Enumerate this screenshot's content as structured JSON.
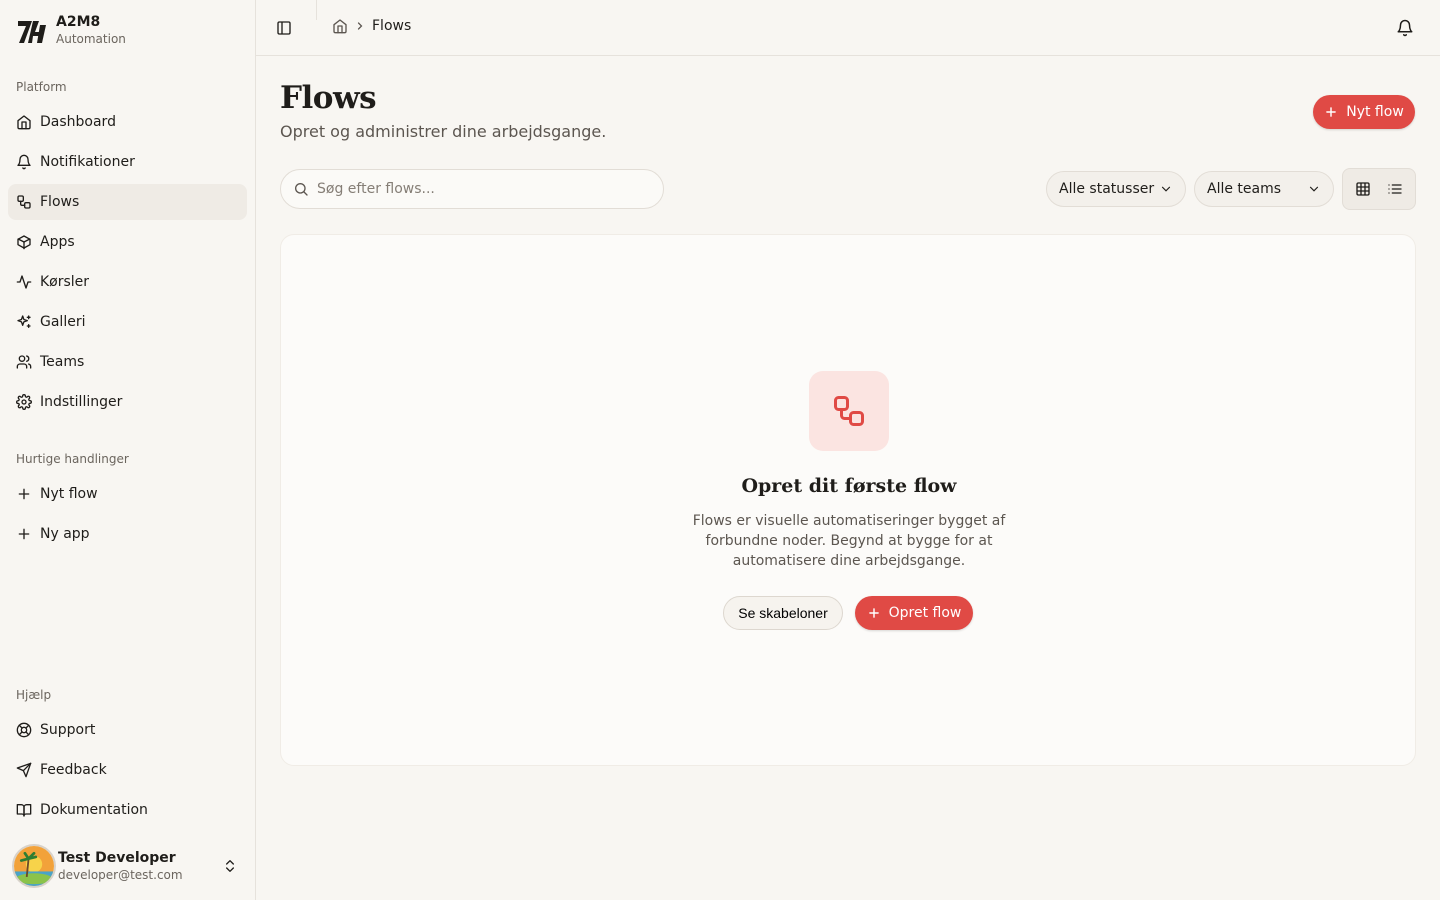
{
  "brand": {
    "name": "A2M8",
    "subtitle": "Automation"
  },
  "sidebar": {
    "platform_label": "Platform",
    "platform_items": [
      {
        "label": "Dashboard",
        "icon": "home-icon"
      },
      {
        "label": "Notifikationer",
        "icon": "bell-icon"
      },
      {
        "label": "Flows",
        "icon": "workflow-icon",
        "active": true
      },
      {
        "label": "Apps",
        "icon": "box-icon"
      },
      {
        "label": "Kørsler",
        "icon": "activity-icon"
      },
      {
        "label": "Galleri",
        "icon": "sparkles-icon"
      },
      {
        "label": "Teams",
        "icon": "users-icon"
      },
      {
        "label": "Indstillinger",
        "icon": "gear-icon"
      }
    ],
    "quick_label": "Hurtige handlinger",
    "quick_items": [
      {
        "label": "Nyt flow",
        "icon": "plus-icon"
      },
      {
        "label": "Ny app",
        "icon": "plus-icon"
      }
    ],
    "help_label": "Hjælp",
    "help_items": [
      {
        "label": "Support",
        "icon": "lifebuoy-icon"
      },
      {
        "label": "Feedback",
        "icon": "send-icon"
      },
      {
        "label": "Dokumentation",
        "icon": "book-icon"
      }
    ]
  },
  "user": {
    "name": "Test Developer",
    "email": "developer@test.com"
  },
  "breadcrumb": {
    "current": "Flows"
  },
  "page": {
    "title": "Flows",
    "subtitle": "Opret og administrer dine arbejdsgange.",
    "new_button": "Nyt flow"
  },
  "filters": {
    "search_placeholder": "Søg efter flows...",
    "status": "Alle statusser",
    "teams": "Alle teams"
  },
  "empty_state": {
    "title": "Opret dit første flow",
    "description": "Flows er visuelle automatiseringer bygget af forbundne noder. Begynd at bygge for at automatisere dine arbejdsgange.",
    "templates_button": "Se skabeloner",
    "create_button": "Opret flow"
  },
  "colors": {
    "accent": "#e04a45",
    "background": "#f8f6f2"
  }
}
